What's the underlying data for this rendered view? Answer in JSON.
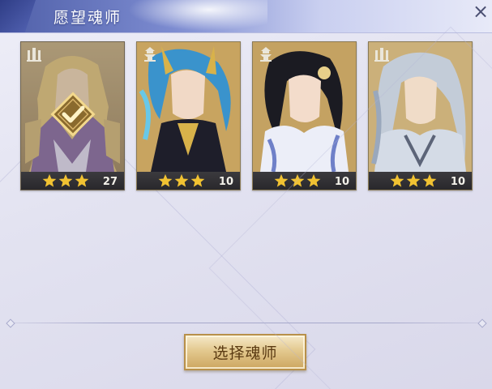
{
  "window": {
    "title": "愿望魂师",
    "close_symbol": "×"
  },
  "cards": [
    {
      "name": "soul-master-card-1",
      "level": "27",
      "stars": 3,
      "type_icon": "tower-icon",
      "selected": true,
      "palette": [
        "#8c6b3a",
        "#c9a55a",
        "#6e4a8a"
      ]
    },
    {
      "name": "soul-master-card-2",
      "level": "10",
      "stars": 3,
      "type_icon": "pagoda-icon",
      "selected": false,
      "palette": [
        "#2e7fb8",
        "#68c8e8",
        "#1e1e2a"
      ]
    },
    {
      "name": "soul-master-card-3",
      "level": "10",
      "stars": 3,
      "type_icon": "pagoda-icon",
      "selected": false,
      "palette": [
        "#1b1b22",
        "#e8e8f2",
        "#6f80c8"
      ]
    },
    {
      "name": "soul-master-card-4",
      "level": "10",
      "stars": 3,
      "type_icon": "tower-icon",
      "selected": false,
      "palette": [
        "#9aa8bc",
        "#d4dbe6",
        "#5c6478"
      ]
    }
  ],
  "actions": {
    "select_label": "选择魂师"
  },
  "colors": {
    "star": "#f1c232",
    "accent_gold": "#d9b46a",
    "header_blue": "#5463ad"
  }
}
